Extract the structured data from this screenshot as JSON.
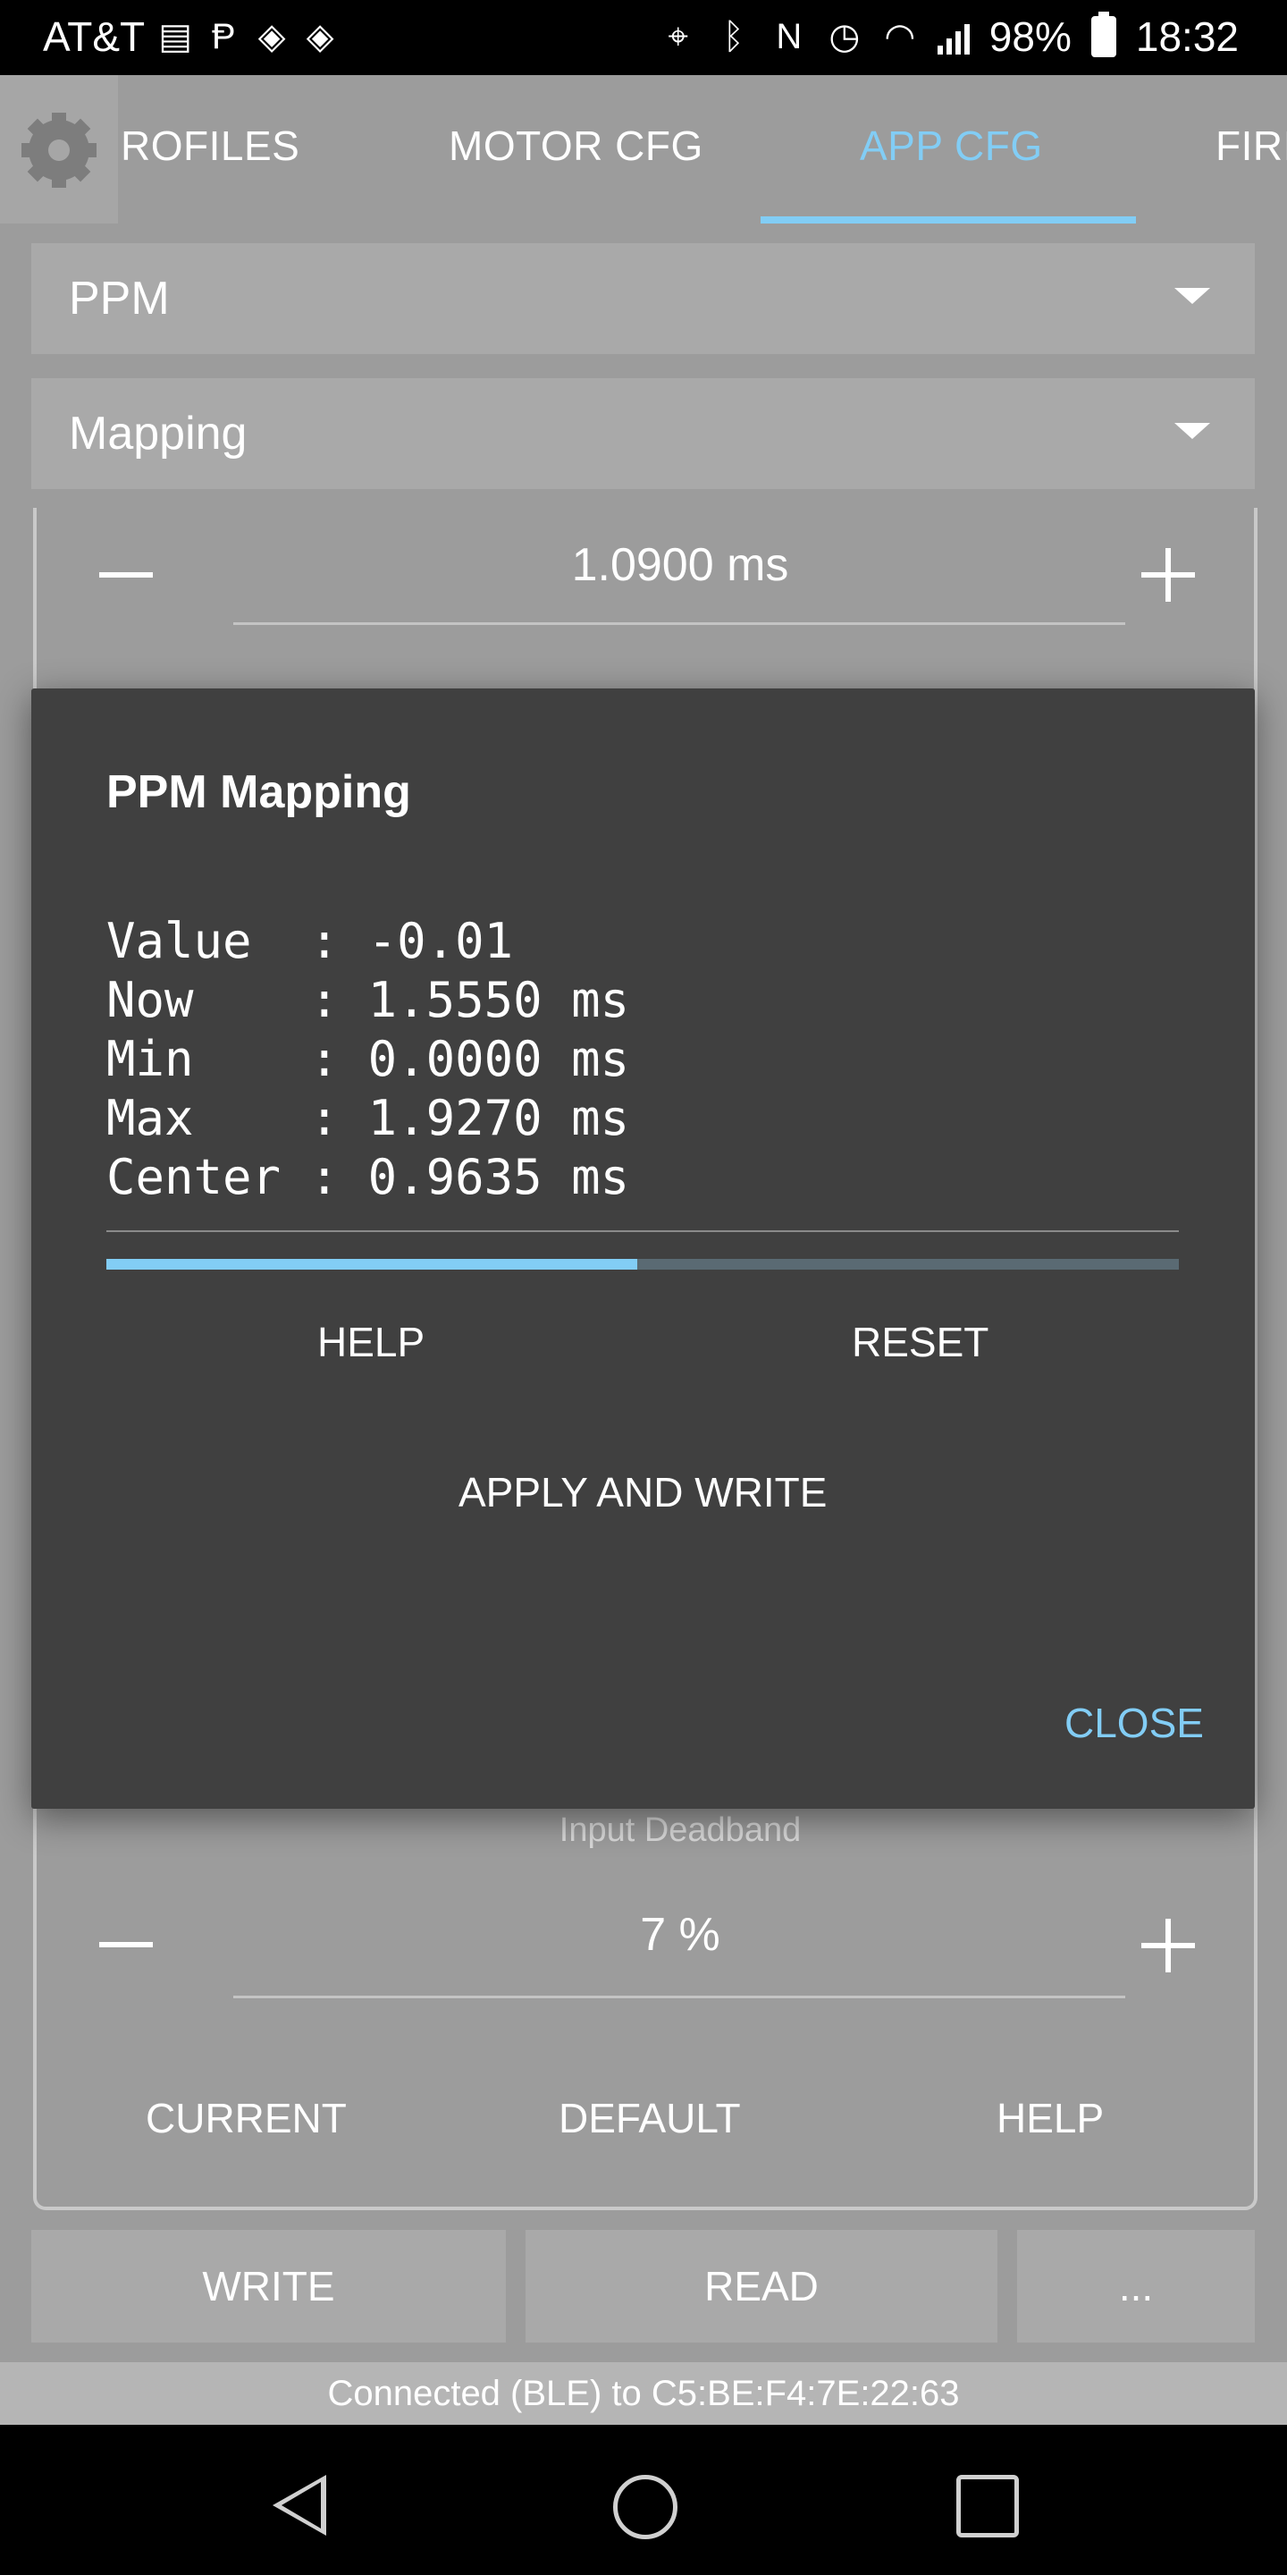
{
  "status_bar": {
    "carrier": "AT&T",
    "battery": "98%",
    "time": "18:32"
  },
  "tabs": [
    {
      "label": "ROFILES"
    },
    {
      "label": "MOTOR CFG"
    },
    {
      "label": "APP CFG"
    },
    {
      "label": "FIRI"
    }
  ],
  "active_tab": "APP CFG",
  "spinners": {
    "app": "PPM",
    "page": "Mapping"
  },
  "top_stepper": {
    "value": "1.0900 ms"
  },
  "deadband": {
    "label": "Input Deadband",
    "value": "7 %"
  },
  "panel_buttons": {
    "current": "CURRENT",
    "default": "DEFAULT",
    "help": "HELP"
  },
  "bottom_buttons": {
    "write": "WRITE",
    "read": "READ",
    "more": "..."
  },
  "connection": "Connected (BLE) to C5:BE:F4:7E:22:63",
  "dialog": {
    "title": "PPM Mapping",
    "lines": [
      "Value  : -0.01",
      "Now    : 1.5550 ms",
      "Min    : 0.0000 ms",
      "Max    : 1.9270 ms",
      "Center : 0.9635 ms"
    ],
    "progress": 0.495,
    "help": "HELP",
    "reset": "RESET",
    "apply": "APPLY AND WRITE",
    "close": "CLOSE"
  },
  "colors": {
    "accent": "#82cdf5",
    "dialog_bg": "#404040",
    "dim_bg": "#9c9c9c"
  }
}
